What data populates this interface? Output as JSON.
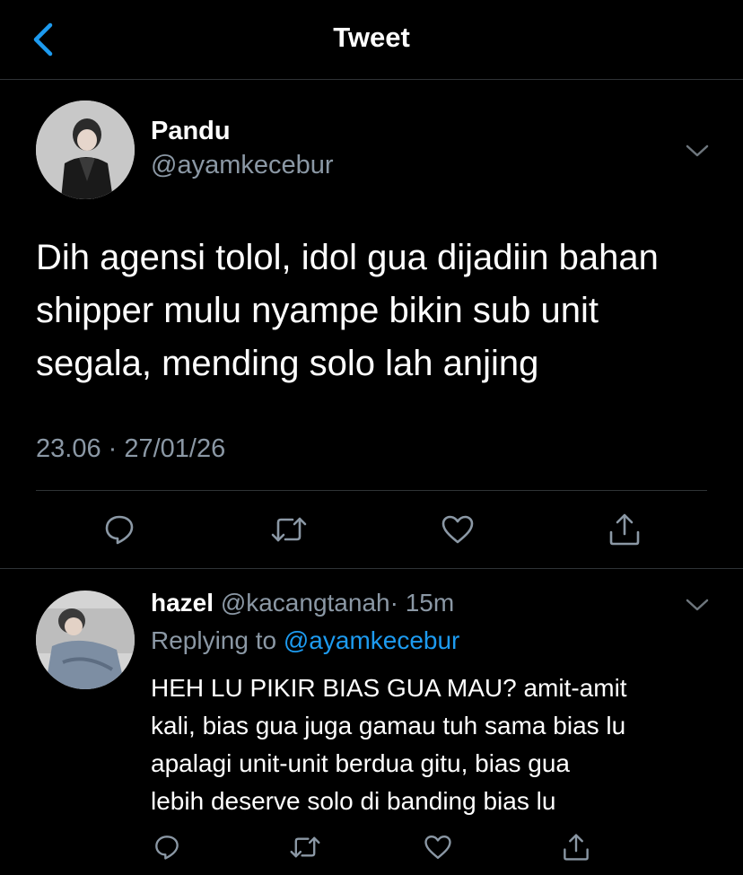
{
  "header": {
    "title": "Tweet",
    "back_icon": "chevron-left-icon",
    "accent_color": "#1d9bf0"
  },
  "tweet": {
    "author_name": "Pandu",
    "author_handle": "@ayamkecebur",
    "text_lines": [
      "Dih agensi tolol, idol gua dijadiin bahan",
      "shipper mulu nyampe bikin sub unit",
      "segala, mending solo lah anjing"
    ],
    "timestamp": "23.06 · 27/01/26",
    "actions": [
      "reply-icon",
      "retweet-icon",
      "like-icon",
      "share-icon"
    ]
  },
  "reply": {
    "author_name": "hazel",
    "author_handle": "@kacangtanah",
    "time": "· 15m",
    "replying_prefix": "Replying to",
    "replying_mention": "@ayamkecebur",
    "text_lines": [
      "HEH LU PIKIR BIAS GUA MAU? amit-amit",
      "kali, bias gua juga gamau tuh sama bias lu",
      "apalagi unit-unit berdua gitu, bias gua",
      "lebih deserve solo di banding bias lu"
    ],
    "actions": [
      "reply-icon",
      "retweet-icon",
      "like-icon",
      "share-icon"
    ]
  }
}
